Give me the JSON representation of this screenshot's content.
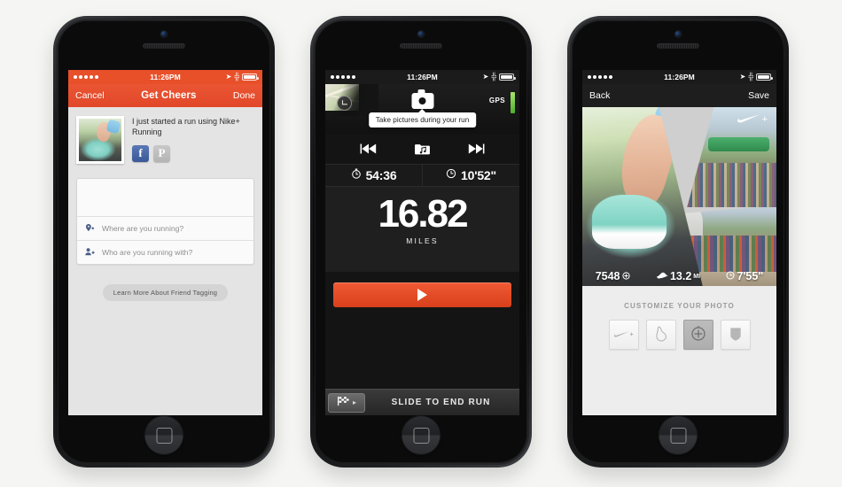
{
  "meta": {
    "background_color": "#f5f5f3",
    "accent_orange": "#e8502a"
  },
  "phone1": {
    "status_bar": {
      "time": "11:26PM",
      "signal_dots": 5,
      "location_icon": "location-arrow-icon",
      "bluetooth_icon": "bluetooth-icon",
      "battery_icon": "battery-icon"
    },
    "navbar": {
      "left_label": "Cancel",
      "title": "Get Cheers",
      "right_label": "Done"
    },
    "share": {
      "message": "I just started a run using Nike+ Running",
      "thumbnail_name": "run-photo-thumbnail",
      "social": [
        {
          "name": "facebook-share-button",
          "glyph": "f"
        },
        {
          "name": "path-share-button",
          "glyph": "P"
        }
      ]
    },
    "form": {
      "note_placeholder": "",
      "rows": [
        {
          "icon": "location-pin-add-icon",
          "label": "Where are you running?"
        },
        {
          "icon": "person-add-icon",
          "label": "Who are you running with?"
        }
      ]
    },
    "learn_more_button": "Learn More About Friend Tagging"
  },
  "phone2": {
    "status_bar": {
      "time": "11:26PM",
      "signal_dots": 5
    },
    "top": {
      "map_badge_icon": "route-map-icon",
      "camera_button": "camera-icon",
      "gps_label": "GPS",
      "gps_strength": "strong",
      "tooltip": "Take pictures during your run"
    },
    "media_controls": [
      {
        "name": "previous-track-button",
        "glyph": "previous-icon"
      },
      {
        "name": "music-library-button",
        "glyph": "music-folder-icon"
      },
      {
        "name": "next-track-button",
        "glyph": "next-icon"
      }
    ],
    "stats": [
      {
        "icon": "stopwatch-icon",
        "value": "54:36"
      },
      {
        "icon": "clock-pace-icon",
        "value": "10'52\""
      }
    ],
    "distance": {
      "value": "16.82",
      "unit": "MILES"
    },
    "play_button": {
      "name": "pause-resume-button",
      "glyph": "play-icon"
    },
    "slider": {
      "knob_icon": "checkered-flag-icon",
      "arrow": "▸",
      "label": "SLIDE TO END RUN"
    }
  },
  "phone3": {
    "status_bar": {
      "time": "11:26PM",
      "signal_dots": 5
    },
    "navbar": {
      "left_label": "Back",
      "right_label": "Save"
    },
    "collage": {
      "brand": {
        "swoosh": "nike-swoosh-icon",
        "plus": "+"
      },
      "photos": [
        "tying-running-shoe-photo",
        "race-start-arch-photo",
        "capitol-marathon-crowd-photo"
      ]
    },
    "photo_stats": [
      {
        "icon": "fuel-points-icon",
        "value": "7548",
        "unit": ""
      },
      {
        "icon": "distance-shoe-icon",
        "value": "13.2",
        "unit": "MI"
      },
      {
        "icon": "pace-clock-icon",
        "value": "7'55\"",
        "unit": ""
      }
    ],
    "customize": {
      "title": "CUSTOMIZE YOUR PHOTO",
      "tiles": [
        {
          "name": "nike-plus-sticker-tile",
          "icon": "nike-swoosh-plus-icon",
          "active": false
        },
        {
          "name": "shoe-sticker-tile",
          "icon": "shoe-outline-icon",
          "active": false
        },
        {
          "name": "stats-sticker-tile",
          "icon": "target-plus-icon",
          "active": true
        },
        {
          "name": "badge-sticker-tile",
          "icon": "shield-badge-icon",
          "active": false
        }
      ]
    }
  }
}
